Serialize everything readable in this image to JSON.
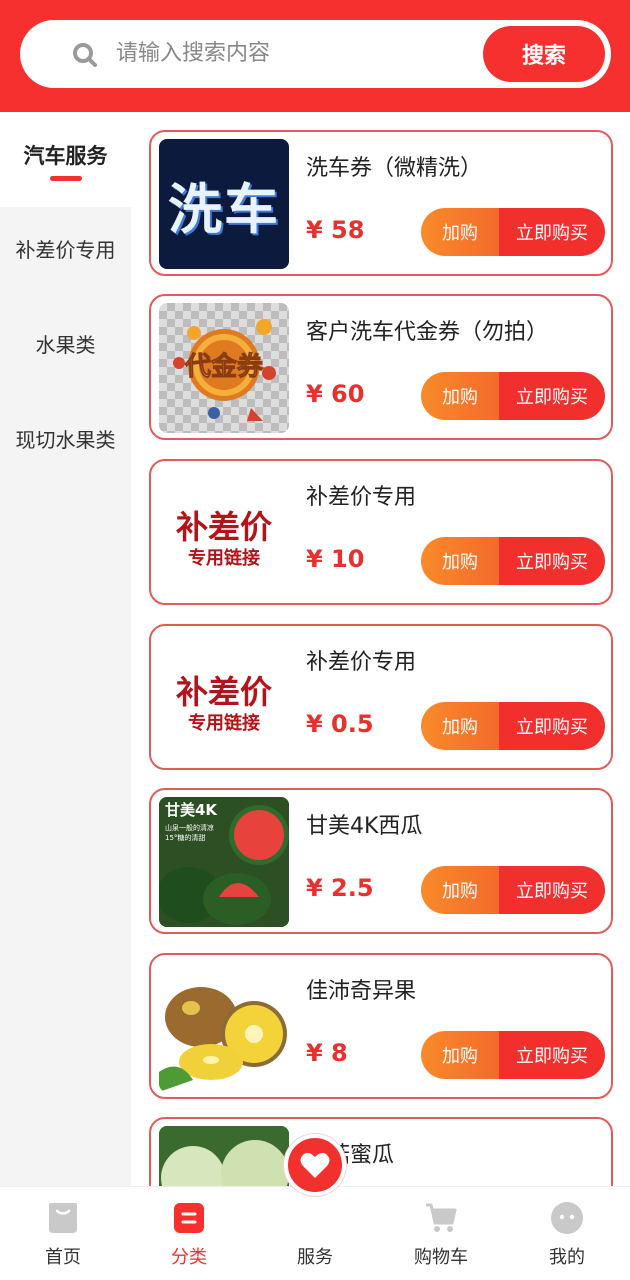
{
  "search": {
    "placeholder": "请输入搜索内容",
    "button": "搜索"
  },
  "sidebar": {
    "items": [
      {
        "label": "汽车服务",
        "active": true
      },
      {
        "label": "补差价专用"
      },
      {
        "label": "水果类"
      },
      {
        "label": "现切水果类"
      }
    ]
  },
  "products": [
    {
      "name": "洗车券（微精洗）",
      "price": "¥ 58",
      "thumb_text": "洗车"
    },
    {
      "name": "客户洗车代金券（勿拍）",
      "price": "¥ 60",
      "thumb_text": "代金券"
    },
    {
      "name": "补差价专用",
      "price": "¥ 10",
      "thumb_line1": "补差价",
      "thumb_line2": "专用链接"
    },
    {
      "name": "补差价专用",
      "price": "¥ 0.5",
      "thumb_line1": "补差价",
      "thumb_line2": "专用链接"
    },
    {
      "name": "甘美4K西瓜",
      "price": "¥ 2.5",
      "thumb_text": "甘美4K",
      "thumb_sub1": "山泉一般的清凉",
      "thumb_sub2": "15°糖的清甜"
    },
    {
      "name": "佳沛奇异果",
      "price": "¥ 8"
    },
    {
      "name": "玉菇蜜瓜"
    }
  ],
  "buttons": {
    "add": "加购",
    "buy": "立即购买"
  },
  "nav": {
    "items": [
      {
        "label": "首页",
        "icon": "home-icon"
      },
      {
        "label": "分类",
        "icon": "category-icon",
        "active": true
      },
      {
        "label": "服务",
        "icon": "heart-icon"
      },
      {
        "label": "购物车",
        "icon": "cart-icon"
      },
      {
        "label": "我的",
        "icon": "profile-icon"
      }
    ]
  },
  "colors": {
    "brand": "#f5302e",
    "accent_orange": "#f98a2a"
  }
}
